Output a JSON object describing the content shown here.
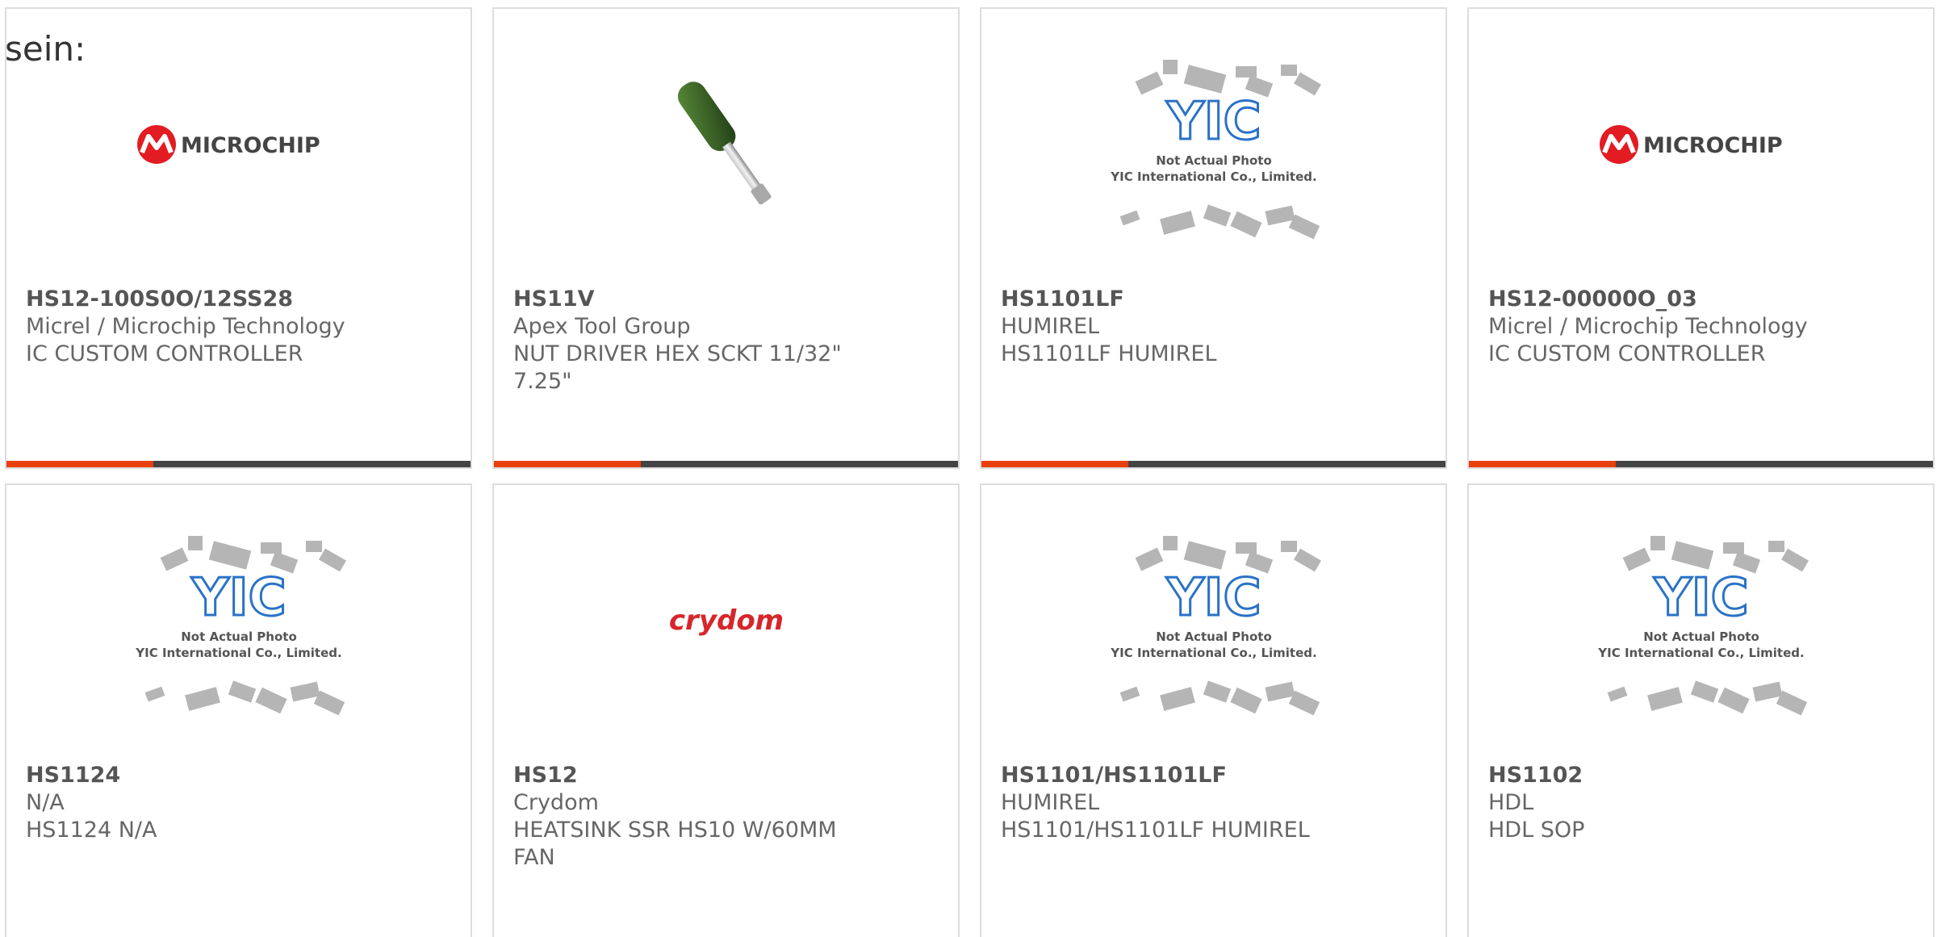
{
  "lead_text": "sein:",
  "colors": {
    "accent": "#e8400c",
    "bar": "#444444",
    "border": "#dddddd",
    "microchip_red": "#e31c23",
    "yic_blue": "#2a72c8",
    "crydom_red": "#d7262a"
  },
  "logos": {
    "microchip": "MICROCHIP",
    "crydom": "crydom",
    "yic_mark": "YIC",
    "yic_line1": "Not Actual Photo",
    "yic_line2": "YIC International Co., Limited."
  },
  "products": [
    {
      "part_no": "HS12-100S0O/12SS28",
      "maker": "Micrel / Microchip Technology",
      "desc": "IC CUSTOM CONTROLLER",
      "image": "microchip-logo"
    },
    {
      "part_no": "HS11V",
      "maker": "Apex Tool Group",
      "desc": "NUT DRIVER HEX SCKT 11/32\" 7.25\"",
      "image": "nut-driver-photo"
    },
    {
      "part_no": "HS1101LF",
      "maker": "HUMIREL",
      "desc": "HS1101LF HUMIREL",
      "image": "yic-placeholder"
    },
    {
      "part_no": "HS12-00000O_03",
      "maker": "Micrel / Microchip Technology",
      "desc": "IC CUSTOM CONTROLLER",
      "image": "microchip-logo"
    },
    {
      "part_no": "HS1124",
      "maker": "N/A",
      "desc": "HS1124 N/A",
      "image": "yic-placeholder"
    },
    {
      "part_no": "HS12",
      "maker": "Crydom",
      "desc": "HEATSINK SSR HS10 W/60MM FAN",
      "image": "crydom-logo"
    },
    {
      "part_no": "HS1101/HS1101LF",
      "maker": "HUMIREL",
      "desc": "HS1101/HS1101LF HUMIREL",
      "image": "yic-placeholder"
    },
    {
      "part_no": "HS1102",
      "maker": "HDL",
      "desc": "HDL SOP",
      "image": "yic-placeholder"
    }
  ]
}
